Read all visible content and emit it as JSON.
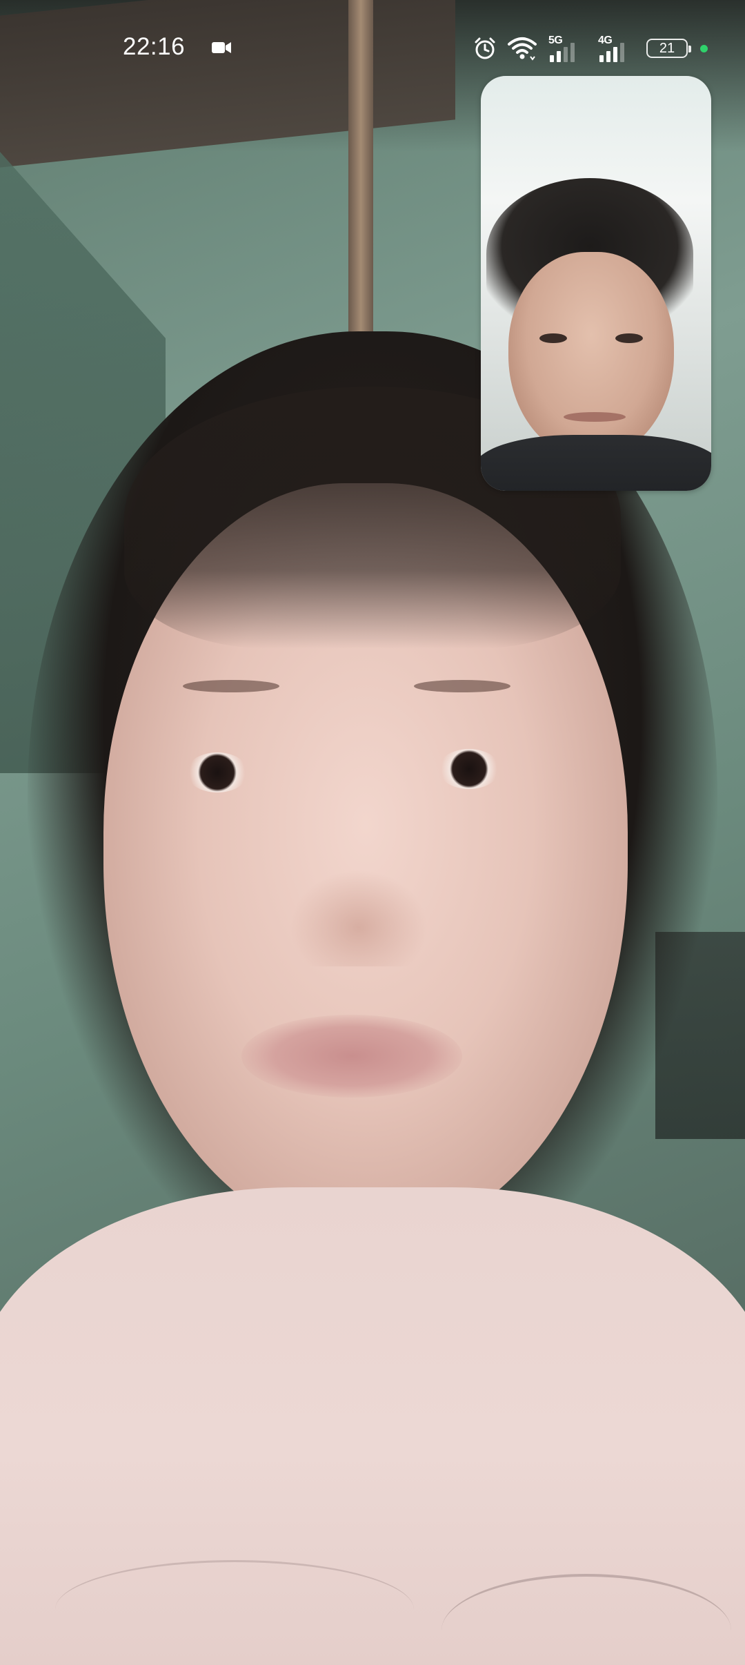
{
  "status_bar": {
    "time": "22:16",
    "recording_icon": "video-camera-icon",
    "alarm_icon": "alarm-icon",
    "wifi_icon": "wifi-icon",
    "sim1_network": "5G",
    "sim2_network": "4G",
    "battery_level": "21",
    "privacy_indicator_color": "#2fd26b"
  },
  "call": {
    "remote_video": "remote-participant-video",
    "self_view": "self-view-video"
  }
}
